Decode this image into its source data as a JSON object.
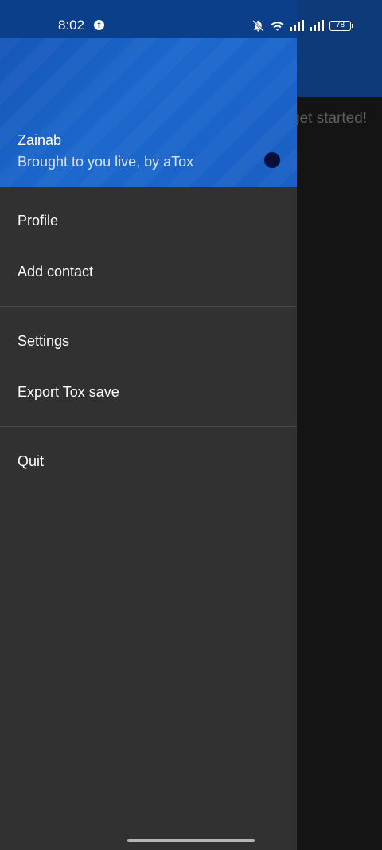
{
  "status_bar": {
    "time": "8:02",
    "facebook_glyph": "f",
    "battery_level": "78"
  },
  "background_app": {
    "hint_text": "get started!"
  },
  "drawer": {
    "user_name": "Zainab",
    "user_status_message": "Brought to you live, by aTox",
    "status_dot_color": "#0a0f3a",
    "header_color": "#1c68cd",
    "menu_items": [
      {
        "label": "Profile"
      },
      {
        "label": "Add contact"
      },
      {
        "label": "Settings"
      },
      {
        "label": "Export Tox save"
      },
      {
        "label": "Quit"
      }
    ]
  }
}
